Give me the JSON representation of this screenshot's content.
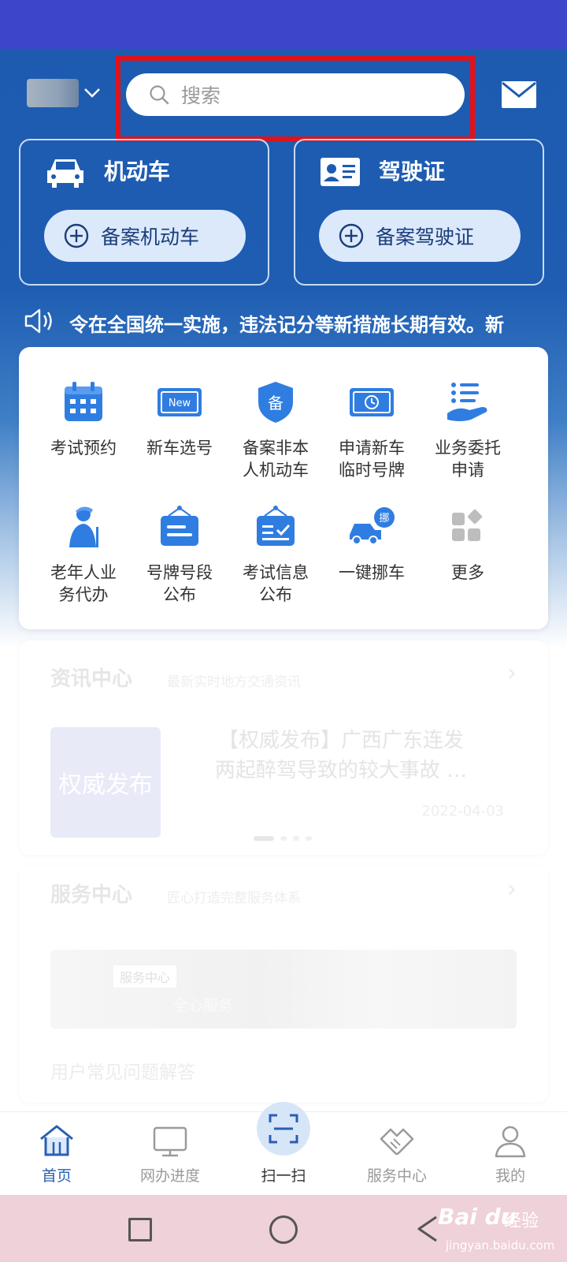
{
  "header": {
    "search_placeholder": "搜索"
  },
  "cards": [
    {
      "title": "机动车",
      "button": "备案机动车",
      "icon": "car-icon"
    },
    {
      "title": "驾驶证",
      "button": "备案驾驶证",
      "icon": "id-card-icon"
    }
  ],
  "notice": {
    "text": "令在全国统一实施，违法记分等新措施长期有效。新"
  },
  "services": [
    {
      "label_1": "考试预约",
      "label_2": "",
      "icon": "calendar-icon"
    },
    {
      "label_1": "新车选号",
      "label_2": "",
      "icon": "new-plate-icon"
    },
    {
      "label_1": "备案非本",
      "label_2": "人机动车",
      "icon": "shield-icon"
    },
    {
      "label_1": "申请新车",
      "label_2": "临时号牌",
      "icon": "temp-plate-icon"
    },
    {
      "label_1": "业务委托",
      "label_2": "申请",
      "icon": "entrust-icon"
    },
    {
      "label_1": "老年人业",
      "label_2": "务代办",
      "icon": "elderly-icon"
    },
    {
      "label_1": "号牌号段",
      "label_2": "公布",
      "icon": "plate-board-icon"
    },
    {
      "label_1": "考试信息",
      "label_2": "公布",
      "icon": "exam-board-icon"
    },
    {
      "label_1": "一键挪车",
      "label_2": "",
      "icon": "move-car-icon"
    },
    {
      "label_1": "更多",
      "label_2": "",
      "icon": "more-grid-icon"
    }
  ],
  "news": {
    "title": "资讯中心",
    "subtitle": "最新实时地方交通资讯",
    "image_text": "权威发布",
    "headline_1": "【权威发布】广西广东连发",
    "headline_2": "两起醉驾导致的较大事故 …",
    "date": "2022-04-03"
  },
  "service_center": {
    "title": "服务中心",
    "subtitle": "匠心打造完整服务体系",
    "banner_tag": "服务中心",
    "banner_text": "全心服务",
    "faq": "用户常见问题解答"
  },
  "tabs": [
    {
      "label": "首页",
      "icon": "home-icon",
      "active": true
    },
    {
      "label": "网办进度",
      "icon": "monitor-icon",
      "active": false
    },
    {
      "label": "扫一扫",
      "icon": "scan-icon",
      "active": false
    },
    {
      "label": "服务中心",
      "icon": "handshake-icon",
      "active": false
    },
    {
      "label": "我的",
      "icon": "user-icon",
      "active": false
    }
  ],
  "watermark": {
    "logo": "Bai du",
    "word": "经验",
    "url": "jingyan.baidu.com"
  },
  "colors": {
    "primary": "#1d5bb0",
    "status_bar": "#3d46c8",
    "highlight": "#e0131b",
    "icon_blue": "#2f7de1"
  }
}
